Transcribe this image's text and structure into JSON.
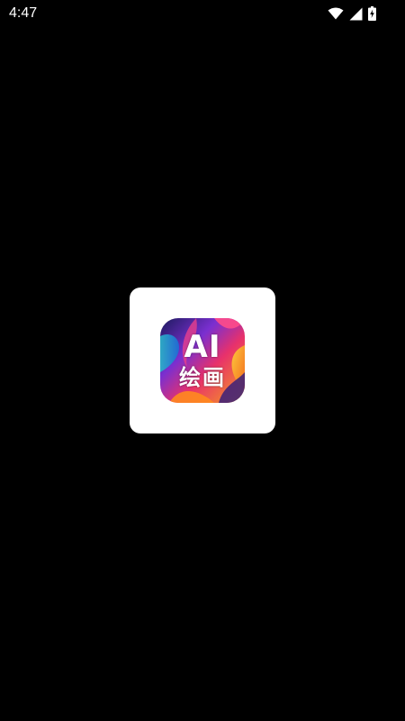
{
  "status_bar": {
    "time": "4:47",
    "icons": [
      "wifi-icon",
      "cellular-signal-icon",
      "battery-charging-icon"
    ],
    "color": "#ffffff"
  },
  "splash": {
    "background_color": "#000000",
    "card_color": "#ffffff",
    "app_icon": {
      "line1": "AI",
      "line2": "绘画",
      "gradient_colors": [
        "#1b1a5c",
        "#e8316b",
        "#f6a21b",
        "#2bb6c9",
        "#7a2fd0"
      ]
    }
  }
}
